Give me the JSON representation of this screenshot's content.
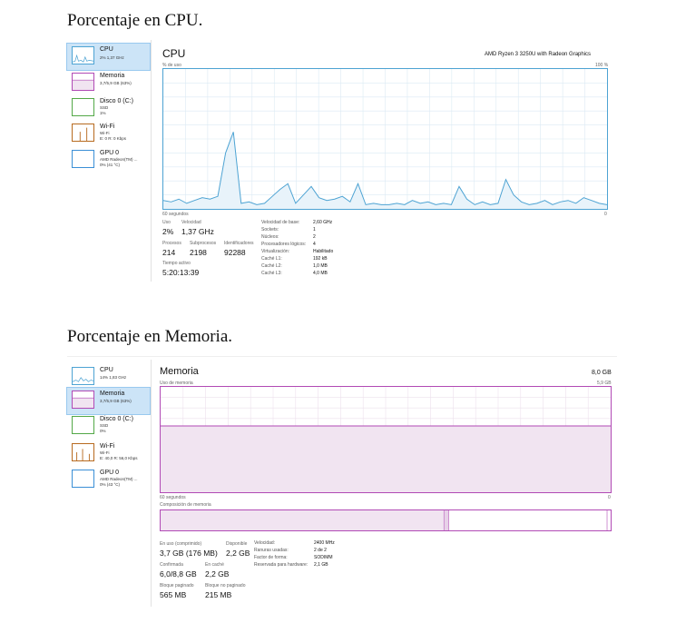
{
  "headings": {
    "cpu": "Porcentaje en CPU.",
    "memory": "Porcentaje en Memoria."
  },
  "colors": {
    "cpu": "#4da3d3",
    "memory": "#b14ab5",
    "disk": "#53a847",
    "wifi": "#b76a1f",
    "gpu": "#3a8fd6",
    "selected": "#cce4f7"
  },
  "cpu_panel": {
    "sidebar": [
      {
        "name": "CPU",
        "sub1": "2% 1,37 GHz",
        "sub2": "",
        "icon": "cpu-graph-thumb"
      },
      {
        "name": "Memoria",
        "sub1": "3,7/5,9 GB (63%)",
        "sub2": "",
        "icon": "memory-graph-thumb"
      },
      {
        "name": "Disco 0 (C:)",
        "sub1": "SSD",
        "sub2": "1%",
        "icon": "disk-graph-thumb"
      },
      {
        "name": "Wi-Fi",
        "sub1": "Wi-Fi",
        "sub2": "E: 0 R: 0 Kbps",
        "icon": "wifi-graph-thumb"
      },
      {
        "name": "GPU 0",
        "sub1": "AMD Radeon(TM) ...",
        "sub2": "0% (41 °C)",
        "icon": "gpu-graph-thumb"
      }
    ],
    "title": "CPU",
    "model": "AMD Ryzen 3 3250U with Radeon Graphics",
    "graph_label": "% de uso",
    "graph_max": "100 %",
    "time_label": "60 segundos",
    "time_end": "0",
    "usage_series": [
      6,
      5,
      7,
      4,
      6,
      8,
      7,
      9,
      40,
      55,
      4,
      5,
      3,
      4,
      9,
      14,
      18,
      4,
      10,
      16,
      8,
      6,
      7,
      9,
      5,
      18,
      3,
      4,
      3,
      3,
      4,
      3,
      6,
      4,
      5,
      3,
      4,
      3,
      16,
      7,
      3,
      5,
      3,
      4,
      21,
      10,
      5,
      3,
      4,
      6,
      3,
      5,
      6,
      4,
      8,
      6,
      4,
      3
    ],
    "stats": {
      "uso_label": "Uso",
      "uso_value": "2%",
      "vel_label": "Velocidad",
      "vel_value": "1,37 GHz",
      "proc_label": "Procesos",
      "proc_value": "214",
      "sub_label": "Subprocesos",
      "sub_value": "2198",
      "id_label": "Identificadores",
      "id_value": "92288",
      "active_label": "Tiempo activo",
      "active_value": "5:20:13:39"
    },
    "details": [
      {
        "k": "Velocidad de base:",
        "v": "2,60 GHz"
      },
      {
        "k": "Sockets:",
        "v": "1"
      },
      {
        "k": "Núcleos:",
        "v": "2"
      },
      {
        "k": "Procesadores lógicos:",
        "v": "4"
      },
      {
        "k": "Virtualización:",
        "v": "Habilitado"
      },
      {
        "k": "Caché L1:",
        "v": "192 kB"
      },
      {
        "k": "Caché L2:",
        "v": "1,0 MB"
      },
      {
        "k": "Caché L3:",
        "v": "4,0 MB"
      }
    ]
  },
  "mem_panel": {
    "sidebar": [
      {
        "name": "CPU",
        "sub1": "14% 1,83 GHz",
        "sub2": "",
        "icon": "cpu-graph-thumb"
      },
      {
        "name": "Memoria",
        "sub1": "3,7/5,9 GB (63%)",
        "sub2": "",
        "icon": "memory-graph-thumb"
      },
      {
        "name": "Disco 0 (C:)",
        "sub1": "SSD",
        "sub2": "0%",
        "icon": "disk-graph-thumb"
      },
      {
        "name": "Wi-Fi",
        "sub1": "Wi-Fi",
        "sub2": "E: 40,0 R: 56,0 Kbps",
        "icon": "wifi-graph-thumb"
      },
      {
        "name": "GPU 0",
        "sub1": "AMD Radeon(TM) ...",
        "sub2": "0% (43 °C)",
        "icon": "gpu-graph-thumb"
      }
    ],
    "title": "Memoria",
    "total": "8,0 GB",
    "graph_label": "Uso de memoria",
    "graph_max": "5,9 GB",
    "time_label": "60 segundos",
    "time_end": "0",
    "usage_fraction": 0.63,
    "composition_label": "Composición de memoria",
    "composition_used_fraction": 0.63,
    "composition_modified_fraction": 0.01,
    "stats": {
      "inuse_label": "En uso (comprimido)",
      "inuse_value": "3,7 GB (176 MB)",
      "avail_label": "Disponible",
      "avail_value": "2,2 GB",
      "commit_label": "Confirmada",
      "commit_value": "6,0/8,8 GB",
      "cache_label": "En caché",
      "cache_value": "2,2 GB",
      "paged_label": "Bloque paginado",
      "paged_value": "565 MB",
      "nonpaged_label": "Bloque no paginado",
      "nonpaged_value": "215 MB"
    },
    "details": [
      {
        "k": "Velocidad:",
        "v": "2400 MHz"
      },
      {
        "k": "Ranuras usadas:",
        "v": "2 de 2"
      },
      {
        "k": "Factor de forma:",
        "v": "SODIMM"
      },
      {
        "k": "Reservada para hardware:",
        "v": "2,1 GB"
      }
    ]
  }
}
